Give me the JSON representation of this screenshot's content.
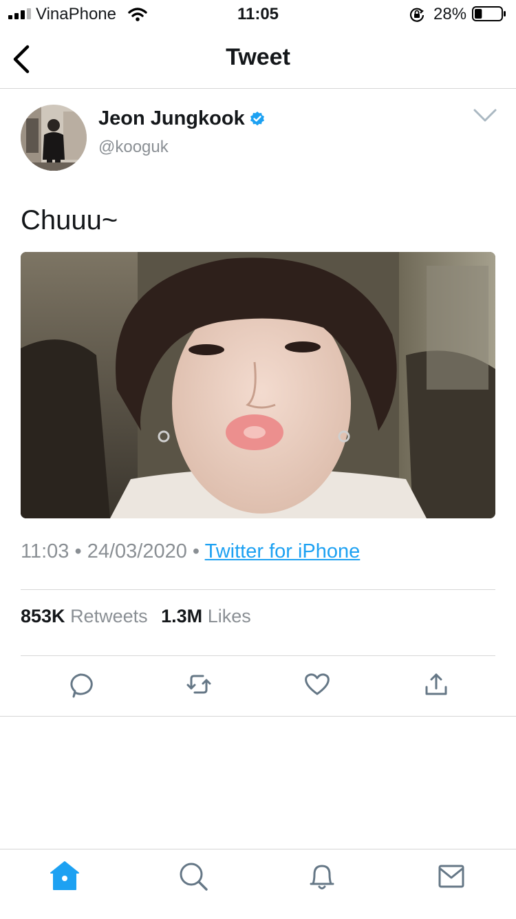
{
  "status_bar": {
    "carrier": "VinaPhone",
    "time": "11:05",
    "battery_percent": "28%",
    "battery_level": 0.28
  },
  "nav": {
    "title": "Tweet"
  },
  "tweet": {
    "author_name": "Jeon Jungkook",
    "author_handle": "@kooguk",
    "verified": true,
    "text": "Chuuu~",
    "time": "11:03",
    "date": "24/03/2020",
    "separator": "•",
    "source": "Twitter for iPhone",
    "retweets_count": "853K",
    "retweets_label": "Retweets",
    "likes_count": "1.3M",
    "likes_label": "Likes"
  },
  "actions": [
    "reply-icon",
    "retweet-icon",
    "like-icon",
    "share-icon"
  ],
  "tabs": [
    "home-icon",
    "search-icon",
    "notifications-icon",
    "messages-icon"
  ],
  "colors": {
    "accent": "#1da1f2",
    "text": "#14171a",
    "secondary": "#8a8f94",
    "icon": "#657786",
    "divider": "#d6d6d6"
  }
}
